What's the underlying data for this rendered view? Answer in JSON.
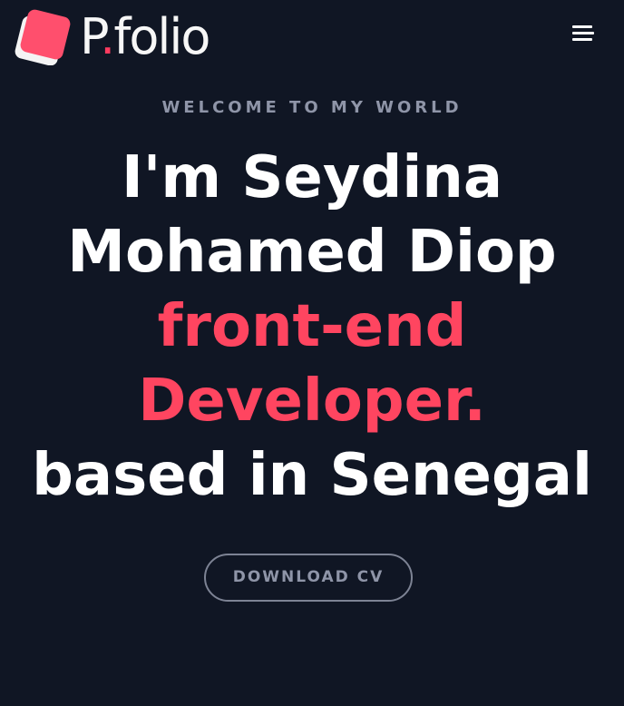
{
  "header": {
    "logo_text": "P",
    "logo_dot": ".",
    "logo_suffix": "folio",
    "menu_icon": "hamburger-menu-icon"
  },
  "hero": {
    "welcome": "WELCOME TO MY WORLD",
    "line1": "I'm Seydina",
    "line2": "Mohamed Diop",
    "line3": "front-end",
    "line4": "Developer.",
    "line5": "based in Senegal",
    "cv_button": "DOWNLOAD CV"
  },
  "colors": {
    "background": "#101624",
    "accent": "#ff4560",
    "muted": "#8f95a8",
    "text": "#ffffff"
  }
}
